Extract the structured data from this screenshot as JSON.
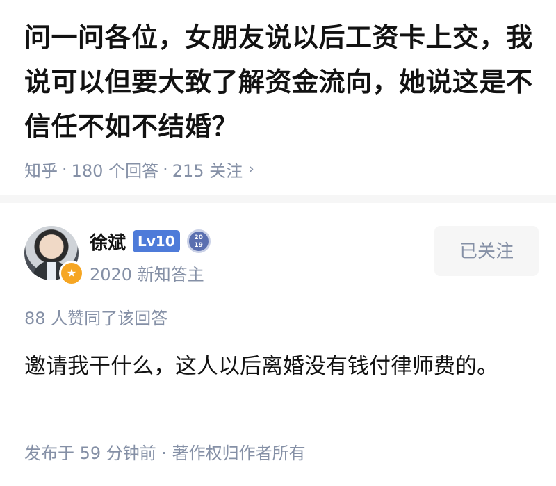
{
  "question": {
    "title": "问一问各位，女朋友说以后工资卡上交，我说可以但要大致了解资金流向，她说这是不信任不如不结婚？",
    "source": "知乎",
    "answer_count": "180 个回答",
    "follower_count": "215 关注",
    "separator": "·",
    "chevron": "›"
  },
  "author": {
    "name": "徐斌",
    "level_badge": "Lv10",
    "medal_text_top": "20",
    "medal_text_bottom": "19",
    "subtitle": "2020 新知答主",
    "badge_icon": "star-icon",
    "follow_button_label": "已关注"
  },
  "answer": {
    "vote_text": "88 人赞同了该回答",
    "body": "邀请我干什么，这人以后离婚没有钱付律师费的。",
    "footer": "发布于 59 分钟前 · 著作权归作者所有"
  }
}
